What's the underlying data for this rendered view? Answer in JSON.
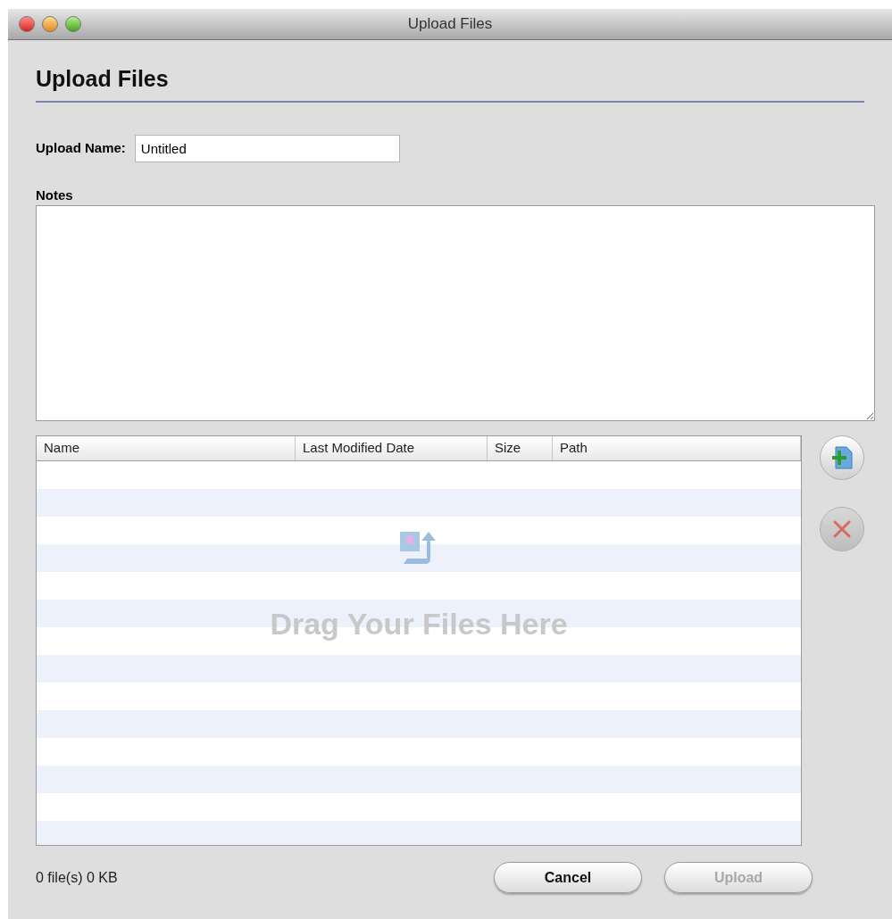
{
  "window": {
    "title": "Upload Files"
  },
  "heading": "Upload Files",
  "upload_name": {
    "label": "Upload Name:",
    "value": "Untitled"
  },
  "notes": {
    "label": "Notes"
  },
  "table": {
    "columns": [
      "Name",
      "Last Modified Date",
      "Size",
      "Path"
    ],
    "empty_hint": "Drag Your Files Here"
  },
  "status": "0 file(s) 0 KB",
  "buttons": [
    {
      "label": "Cancel",
      "disabled": false
    },
    {
      "label": "Upload",
      "disabled": true
    }
  ]
}
